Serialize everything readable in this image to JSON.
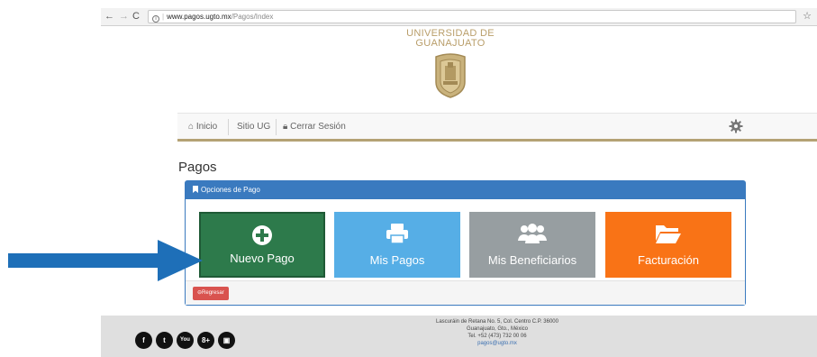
{
  "browser": {
    "url_host": "www.pagos.ugto.mx",
    "url_path": "/Pagos/Index"
  },
  "header": {
    "university_line1": "UNIVERSIDAD DE",
    "university_line2": "GUANAJUATO"
  },
  "nav": {
    "items": [
      {
        "label": "Inicio",
        "icon": "home-icon"
      },
      {
        "label": "Sitio UG",
        "icon": ""
      },
      {
        "label": "Cerrar Sesión",
        "icon": "lock-icon"
      }
    ],
    "settings_icon": "gear-icon"
  },
  "main": {
    "title": "Pagos",
    "panel_title": "Opciones de Pago",
    "tiles": [
      {
        "label": "Nuevo Pago",
        "icon": "plus-circle-icon",
        "color": "#2d7a4b"
      },
      {
        "label": "Mis Pagos",
        "icon": "printer-icon",
        "color": "#56aee6"
      },
      {
        "label": "Mis Beneficiarios",
        "icon": "users-icon",
        "color": "#979ea1"
      },
      {
        "label": "Facturación",
        "icon": "folder-open-icon",
        "color": "#f97316"
      }
    ],
    "back_label": "Regresar"
  },
  "footer": {
    "address_line1": "Lascuráin de Retana No. 5, Col. Centro C.P. 36000",
    "address_line2": "Guanajuato, Gto., México",
    "phone": "Tel. +52 (473) 732 00 06",
    "email": "pagos@ugto.mx",
    "social": [
      "facebook-icon",
      "twitter-icon",
      "youtube-icon",
      "google-plus-icon",
      "instagram-icon"
    ]
  },
  "colors": {
    "primary": "#3a7abf",
    "gold": "#b99e6a",
    "danger": "#d9534f",
    "arrow": "#1e6fb8"
  }
}
